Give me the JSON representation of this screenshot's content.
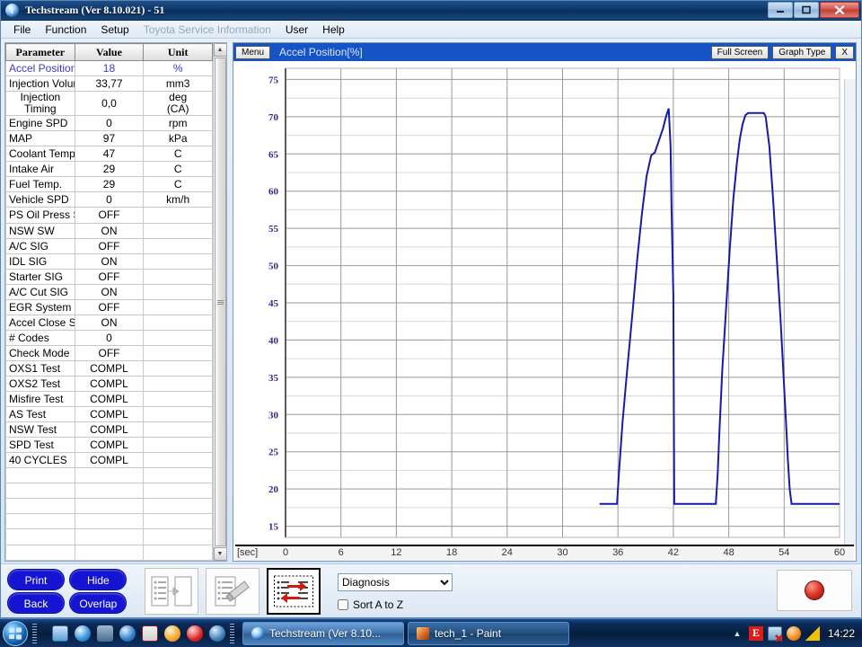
{
  "window": {
    "title": "Techstream (Ver 8.10.021) - 51",
    "icon": "techstream-logo-icon",
    "buttons": {
      "minimize": "–",
      "maximize": "□",
      "close": "✕"
    }
  },
  "menu": [
    {
      "label": "File",
      "disabled": false
    },
    {
      "label": "Function",
      "disabled": false
    },
    {
      "label": "Setup",
      "disabled": false
    },
    {
      "label": "Toyota Service Information",
      "disabled": true
    },
    {
      "label": "User",
      "disabled": false
    },
    {
      "label": "Help",
      "disabled": false
    }
  ],
  "param_table": {
    "headers": [
      "Parameter",
      "Value",
      "Unit"
    ],
    "rows": [
      {
        "name": "Accel Position",
        "value": "18",
        "unit": "%",
        "highlight": true
      },
      {
        "name": "Injection Volume",
        "value": "33,77",
        "unit": "mm3",
        "highlight": false
      },
      {
        "name": "Injection Timing",
        "value": "0,0",
        "unit": "deg (CA)",
        "highlight": false,
        "tall": true
      },
      {
        "name": "Engine SPD",
        "value": "0",
        "unit": "rpm",
        "highlight": false
      },
      {
        "name": "MAP",
        "value": "97",
        "unit": "kPa",
        "highlight": false
      },
      {
        "name": "Coolant Temp",
        "value": "47",
        "unit": "C",
        "highlight": false
      },
      {
        "name": "Intake Air",
        "value": "29",
        "unit": "C",
        "highlight": false
      },
      {
        "name": "Fuel Temp.",
        "value": "29",
        "unit": "C",
        "highlight": false
      },
      {
        "name": "Vehicle SPD",
        "value": "0",
        "unit": "km/h",
        "highlight": false
      },
      {
        "name": "PS Oil Press SW",
        "value": "OFF",
        "unit": "",
        "highlight": false
      },
      {
        "name": "NSW SW",
        "value": "ON",
        "unit": "",
        "highlight": false
      },
      {
        "name": "A/C SIG",
        "value": "OFF",
        "unit": "",
        "highlight": false
      },
      {
        "name": "IDL SIG",
        "value": "ON",
        "unit": "",
        "highlight": false
      },
      {
        "name": "Starter SIG",
        "value": "OFF",
        "unit": "",
        "highlight": false
      },
      {
        "name": "A/C Cut SIG",
        "value": "ON",
        "unit": "",
        "highlight": false
      },
      {
        "name": "EGR System",
        "value": "OFF",
        "unit": "",
        "highlight": false
      },
      {
        "name": "Accel Close SW",
        "value": "ON",
        "unit": "",
        "highlight": false
      },
      {
        "name": "# Codes",
        "value": "0",
        "unit": "",
        "highlight": false
      },
      {
        "name": "Check Mode",
        "value": "OFF",
        "unit": "",
        "highlight": false
      },
      {
        "name": "OXS1 Test",
        "value": "COMPL",
        "unit": "",
        "highlight": false
      },
      {
        "name": "OXS2 Test",
        "value": "COMPL",
        "unit": "",
        "highlight": false
      },
      {
        "name": "Misfire Test",
        "value": "COMPL",
        "unit": "",
        "highlight": false
      },
      {
        "name": "AS Test",
        "value": "COMPL",
        "unit": "",
        "highlight": false
      },
      {
        "name": "NSW Test",
        "value": "COMPL",
        "unit": "",
        "highlight": false
      },
      {
        "name": "SPD Test",
        "value": "COMPL",
        "unit": "",
        "highlight": false
      },
      {
        "name": "40 CYCLES",
        "value": "COMPL",
        "unit": "",
        "highlight": false
      },
      {
        "name": "",
        "value": "",
        "unit": "",
        "highlight": false
      },
      {
        "name": "",
        "value": "",
        "unit": "",
        "highlight": false
      },
      {
        "name": "",
        "value": "",
        "unit": "",
        "highlight": false
      },
      {
        "name": "",
        "value": "",
        "unit": "",
        "highlight": false
      },
      {
        "name": "",
        "value": "",
        "unit": "",
        "highlight": false
      },
      {
        "name": "",
        "value": "",
        "unit": "",
        "highlight": false
      }
    ],
    "scroll": {
      "up_arrow": "▲",
      "down_arrow": "▼"
    }
  },
  "graph_panel": {
    "menu_button": "Menu",
    "title": "Accel Position[%]",
    "full_screen_button": "Full Screen",
    "graph_type_button": "Graph Type",
    "close_button": "X"
  },
  "chart_data": {
    "type": "line",
    "title": "Accel Position[%]",
    "xlabel": "[sec]",
    "ylabel": "",
    "xlim": [
      0,
      60
    ],
    "ylim": [
      13.5,
      76.5
    ],
    "xticks": [
      0,
      6,
      12,
      18,
      24,
      30,
      36,
      42,
      48,
      54,
      60
    ],
    "yticks": [
      15,
      20,
      25,
      30,
      35,
      40,
      45,
      50,
      55,
      60,
      65,
      70,
      75
    ],
    "minor_y_step": 2.5,
    "grid": true,
    "legend": "none",
    "line_color": "#1a1aa8",
    "series": [
      {
        "name": "Accel Position",
        "x": [
          34.0,
          35.9,
          36.1,
          36.5,
          37.0,
          37.6,
          38.1,
          38.6,
          39.1,
          39.6,
          40.0,
          40.3,
          40.6,
          40.9,
          41.1,
          41.3,
          41.5,
          41.7,
          41.8,
          42.0,
          42.1,
          46.6,
          46.8,
          47.0,
          47.3,
          47.7,
          48.1,
          48.5,
          48.9,
          49.2,
          49.5,
          49.8,
          50.1,
          51.8,
          52.0,
          52.4,
          52.8,
          53.2,
          53.6,
          53.9,
          54.2,
          54.4,
          54.6,
          54.8,
          60.0
        ],
        "y": [
          18.0,
          18.0,
          22.0,
          29.0,
          36.0,
          44.0,
          51.0,
          57.0,
          62.0,
          64.8,
          65.2,
          66.3,
          67.4,
          68.5,
          69.5,
          70.4,
          71.1,
          66.0,
          58.0,
          46.0,
          18.0,
          18.0,
          22.0,
          28.0,
          36.0,
          44.0,
          52.0,
          59.0,
          64.0,
          67.0,
          69.0,
          70.2,
          70.5,
          70.5,
          70.0,
          66.0,
          59.0,
          51.0,
          43.0,
          36.0,
          29.0,
          24.0,
          20.0,
          18.0,
          18.0
        ]
      }
    ]
  },
  "bottom_bar": {
    "pills": [
      {
        "label": "Print",
        "name": "print-button"
      },
      {
        "label": "Hide",
        "name": "hide-button"
      },
      {
        "label": "Back",
        "name": "back-button"
      },
      {
        "label": "Overlap",
        "name": "overlap-button"
      }
    ],
    "tools": [
      {
        "name": "copy-list-icon",
        "active": false
      },
      {
        "name": "edit-list-icon",
        "active": false
      },
      {
        "name": "swap-lists-icon",
        "active": true
      }
    ],
    "dropdown": {
      "value": "Diagnosis",
      "options": [
        "Diagnosis"
      ],
      "arrow": "▼"
    },
    "checkbox": {
      "label": "Sort A to Z",
      "checked": false
    },
    "record_button": "record-button"
  },
  "taskbar": {
    "start": "start-orb",
    "quick_launch": [
      "media-center-icon",
      "internet-explorer-icon",
      "tools-icon",
      "media-player-icon",
      "save-icon",
      "sun-icon",
      "yandex-icon",
      "opera-icon"
    ],
    "tasks": [
      {
        "label": "Techstream (Ver 8.10...",
        "icon": "techstream-logo-icon",
        "active": true
      },
      {
        "label": "tech_1 - Paint",
        "icon": "paint-icon",
        "active": false
      }
    ],
    "tray": {
      "expand": "▲",
      "icons": [
        "eset-icon",
        "network-error-icon",
        "update-icon",
        "warning-icon"
      ],
      "clock": "14:22"
    }
  }
}
